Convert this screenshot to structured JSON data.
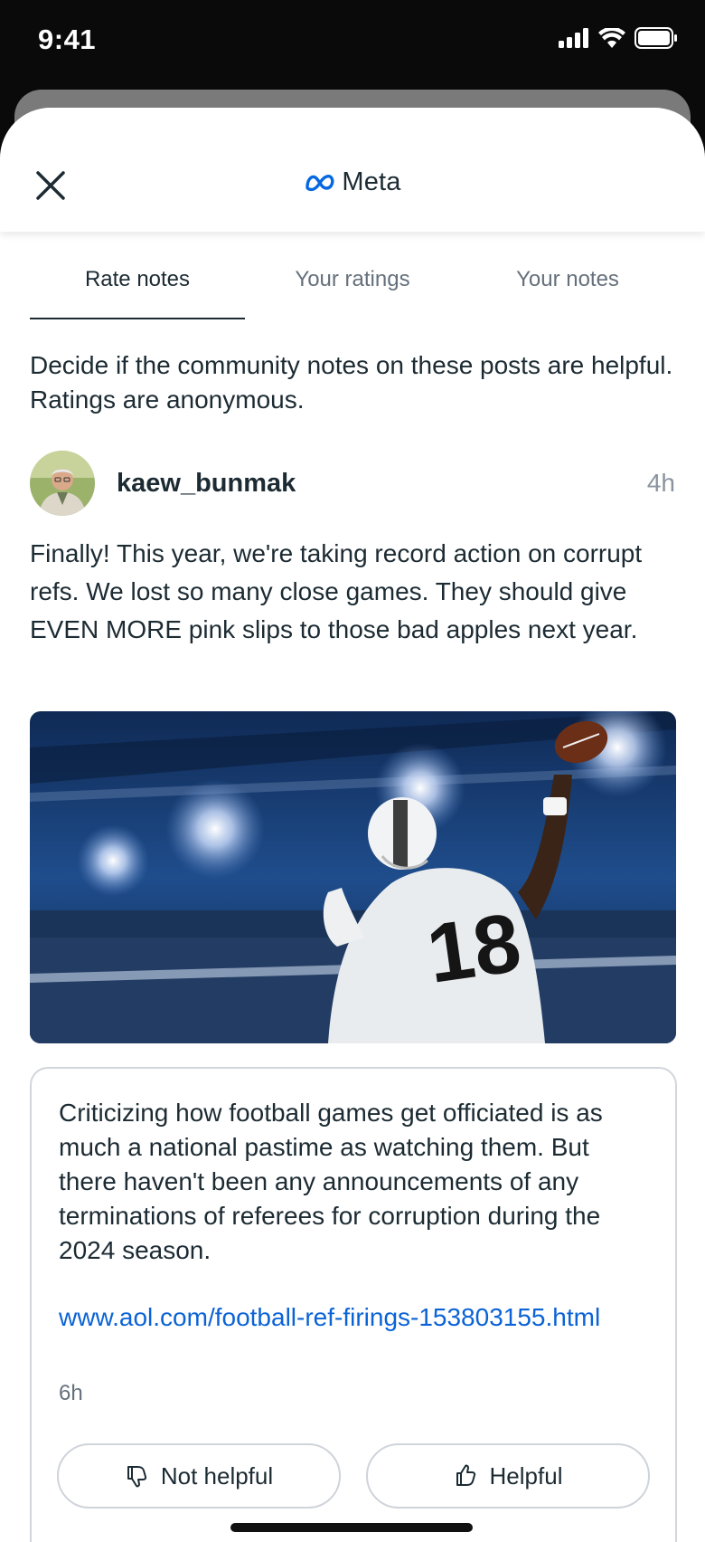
{
  "status_bar": {
    "time": "9:41"
  },
  "header": {
    "brand": "Meta"
  },
  "tabs": [
    {
      "label": "Rate notes",
      "active": true
    },
    {
      "label": "Your ratings",
      "active": false
    },
    {
      "label": "Your notes",
      "active": false
    }
  ],
  "intro": "Decide if the community notes on these posts are helpful. Ratings are anonymous.",
  "post": {
    "username": "kaew_bunmak",
    "time": "4h",
    "text": "Finally! This year, we're taking record action on corrupt refs. We lost so many close games. They should give EVEN MORE pink slips to those bad apples next year.",
    "image_jersey_number": "18"
  },
  "note": {
    "text": "Criticizing how football games get officiated is as much a national pastime as watching them. But there haven't been any announcements of any terminations of referees for corruption during the 2024 season.",
    "link": "www.aol.com/football-ref-firings-153803155.html",
    "time": "6h",
    "not_helpful_label": "Not helpful",
    "helpful_label": "Helpful"
  },
  "colors": {
    "link": "#0b63d6",
    "text": "#1c2b33",
    "meta_blue": "#0668E1"
  }
}
